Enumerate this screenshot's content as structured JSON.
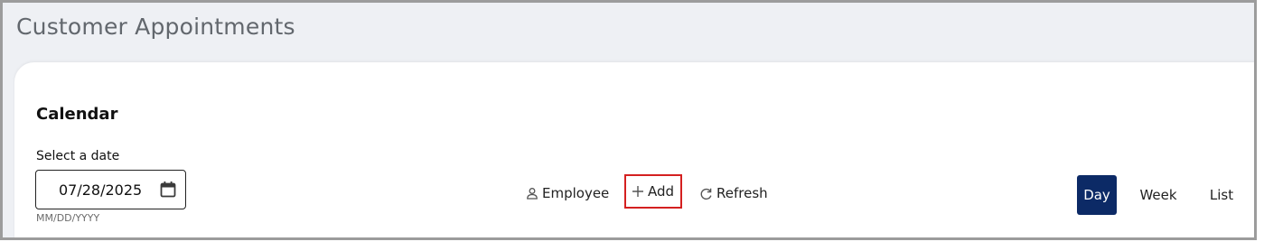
{
  "page": {
    "title": "Customer Appointments"
  },
  "calendar": {
    "heading": "Calendar",
    "date_label": "Select a date",
    "date_value": "07/28/2025",
    "date_format_hint": "MM/DD/YYYY"
  },
  "actions": {
    "employee": "Employee",
    "add": "Add",
    "refresh": "Refresh"
  },
  "views": {
    "day": "Day",
    "week": "Week",
    "list": "List",
    "selected": "Day"
  },
  "colors": {
    "selected_view_bg": "#0c2a66",
    "highlight_border": "#d42020"
  }
}
